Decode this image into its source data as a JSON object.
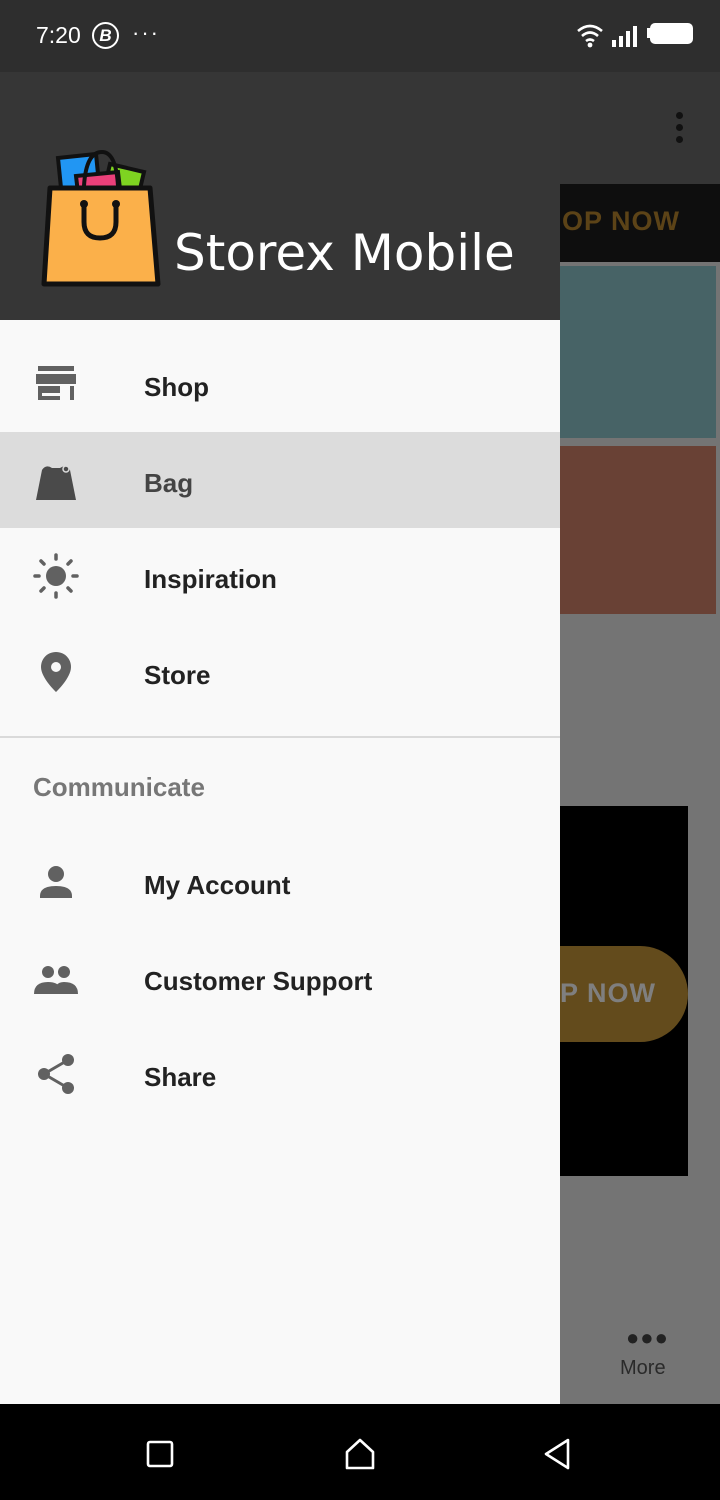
{
  "status_bar": {
    "time": "7:20",
    "b_badge": "B",
    "dots": "···",
    "icons": [
      "wifi-icon",
      "signal-icon",
      "battery-icon"
    ]
  },
  "background_app": {
    "banner_cta": "HOP NOW",
    "pill_cta": "OP NOW",
    "bottom_more_label": "More"
  },
  "drawer": {
    "title": "Storex Mobile",
    "primary_items": [
      {
        "label": "Shop",
        "icon": "store-icon",
        "selected": false
      },
      {
        "label": "Bag",
        "icon": "bag-icon",
        "selected": true
      },
      {
        "label": "Inspiration",
        "icon": "brightness-icon",
        "selected": false
      },
      {
        "label": "Store",
        "icon": "location-pin-icon",
        "selected": false
      }
    ],
    "section_title": "Communicate",
    "secondary_items": [
      {
        "label": "My Account",
        "icon": "person-icon"
      },
      {
        "label": "Customer Support",
        "icon": "people-icon"
      },
      {
        "label": "Share",
        "icon": "share-icon"
      }
    ]
  },
  "nav_bar": {
    "buttons": [
      "recent-apps-icon",
      "home-icon",
      "back-icon"
    ]
  },
  "colors": {
    "header_bg": "#363636",
    "drawer_bg": "#f9f9f9",
    "selected_bg": "#dcdcdc",
    "bag_orange": "#fbb04a"
  }
}
